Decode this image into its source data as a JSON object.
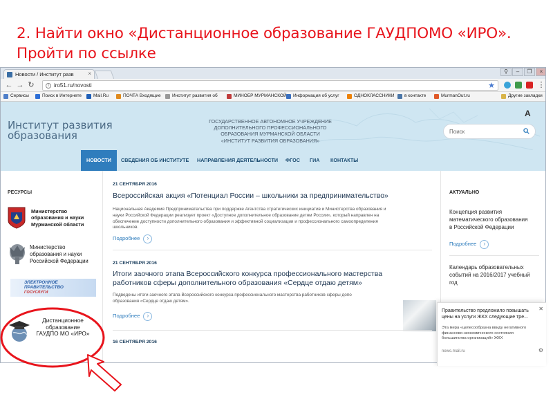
{
  "slide": {
    "title_line1": "2. Найти окно «Дистанционное образование ГАУДПОМО «ИРО».",
    "title_line2": "Пройти по ссылке",
    "title_color": "#e8141c"
  },
  "browser": {
    "tab_title": "Новости / Институт разв",
    "url": "iro51.ru/novosti",
    "bookmarks": [
      {
        "label": "Сервисы",
        "color": "#4f7fc9"
      },
      {
        "label": "Поиск в Интернете",
        "color": "#2f6fd6"
      },
      {
        "label": "Mail.Ru",
        "color": "#1e5fb8"
      },
      {
        "label": "ПОЧТА Входящие",
        "color": "#e08a1e"
      },
      {
        "label": "Институт развития об",
        "color": "#999999"
      },
      {
        "label": "МИНОБР МУРМАНСКОЙ",
        "color": "#c03b3b"
      },
      {
        "label": "Информация об услуг",
        "color": "#3a70c0"
      },
      {
        "label": "ОДНОКЛАССНИКИ",
        "color": "#ee8208"
      },
      {
        "label": "в контакте",
        "color": "#4a76a8"
      },
      {
        "label": "MurmanOut.ru",
        "color": "#e05a2a"
      },
      {
        "label": "Другие закладки",
        "color": "#d8b44a"
      }
    ]
  },
  "site": {
    "logo_line1": "Институт развития",
    "logo_line2": "образования",
    "org_lines": [
      "ГОСУДАРСТВЕННОЕ АВТОНОМНОЕ УЧРЕЖДЕНИЕ",
      "ДОПОЛНИТЕЛЬНОГО ПРОФЕССИОНАЛЬНОГО",
      "ОБРАЗОВАНИЯ МУРМАНСКОЙ ОБЛАСТИ",
      "«ИНСТИТУТ РАЗВИТИЯ ОБРАЗОВАНИЯ»"
    ],
    "font_toggle": "A",
    "search_placeholder": "Поиск",
    "nav": [
      "НОВОСТИ",
      "СВЕДЕНИЯ ОБ ИНСТИТУТЕ",
      "НАПРАВЛЕНИЯ ДЕЯТЕЛЬНОСТИ",
      "ФГОС",
      "ГИА",
      "КОНТАКТЫ"
    ],
    "resources_heading": "РЕСУРСЫ",
    "resources": [
      {
        "line1": "Министерство",
        "line2": "образования и науки",
        "line3": "Мурманской области"
      },
      {
        "line1": "Министерство",
        "line2": "образования и науки",
        "line3": "Российской Федерации"
      },
      {
        "line1": "ЭЛЕКТРОННОЕ",
        "line2": "ПРАВИТЕЛЬСТВО",
        "line3": "ГОСУСЛУГИ"
      },
      {
        "line1": "Дистанционное",
        "line2": "образование",
        "line3": "ГАУДПО МО «ИРО»"
      }
    ],
    "news": [
      {
        "date": "21 СЕНТЯБРЯ 2016",
        "headline": "Всероссийская акция «Потенциал России – школьники за предпринимательство»",
        "desc_lines": [
          "Национальная Академия Предпринимательства при поддержке Агентства стратегических инициатив и Министерства образования и",
          "науки Российской Федерации реализует проект «Доступное дополнительное образование детям России», который направлен на",
          "обеспечение доступности дополнительного образования и эффективной социализации и профессионального самоопределения",
          "школьников."
        ],
        "more": "Подробнее"
      },
      {
        "date": "21 СЕНТЯБРЯ 2016",
        "headline_line1": "Итоги заочного этапа Всероссийского конкурса профессионального мастерства",
        "headline_line2": "работников сферы дополнительного образования «Сердце отдаю детям»",
        "desc_lines": [
          "Подведены итоги заочного этапа Всероссийского конкурса профессионального мастерства работников сферы допо",
          "образования «Сердце отдаю детям»."
        ],
        "more": "Подробнее"
      },
      {
        "date": "16 СЕНТЯБРЯ 2016"
      }
    ],
    "aktualno_heading": "АКТУАЛЬНО",
    "aktualno": [
      {
        "lines": [
          "Концепция развития",
          "математического образования",
          "в Российской Федерации"
        ],
        "more": "Подробнее"
      },
      {
        "lines": [
          "Календарь образовательных",
          "событий на 2016/2017 учебный",
          "год"
        ]
      }
    ]
  },
  "notification": {
    "title_lines": [
      "Правительство предложило повышать",
      "цены на услуги ЖКХ следующие тре..."
    ],
    "body_lines": [
      "Эта мера «целесообразна ввиду негативного",
      "финансово-экономического состояния",
      "большинства организаций» ЖКХ"
    ],
    "source": "news.mail.ru"
  }
}
